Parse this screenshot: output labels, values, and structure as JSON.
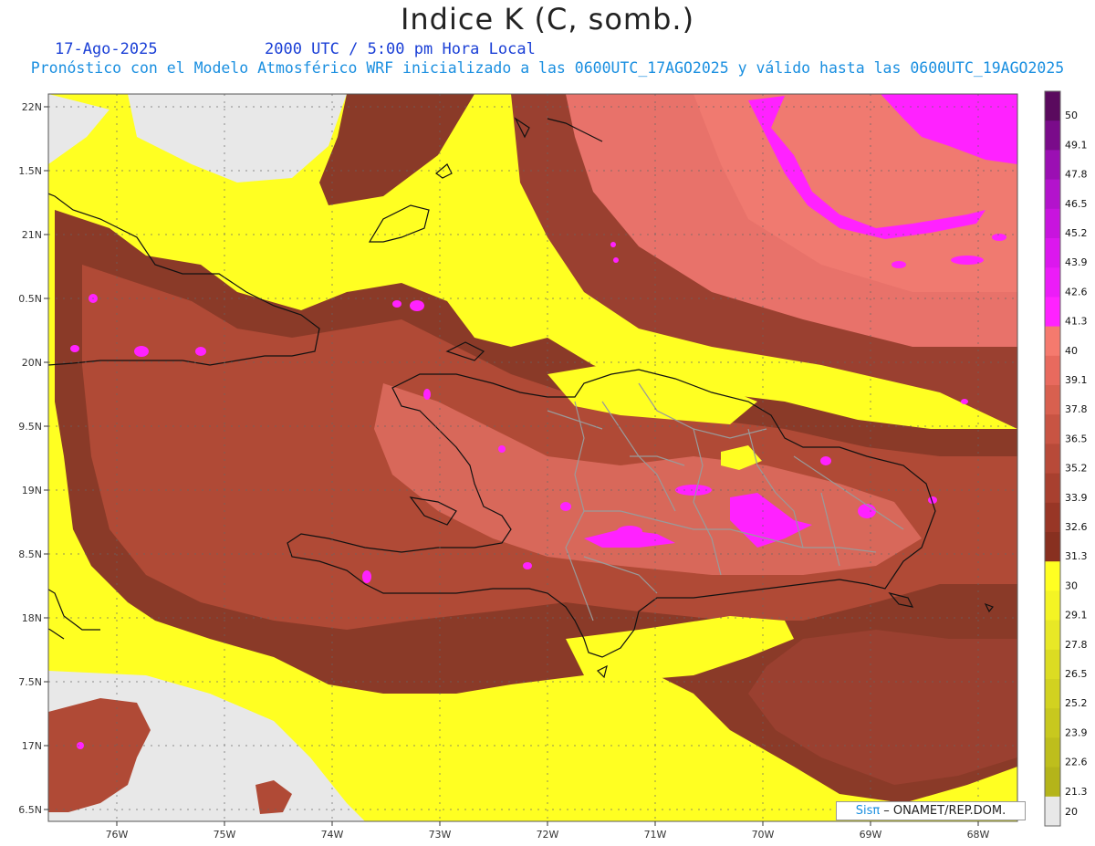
{
  "header": {
    "title": "Indice K (C, somb.)",
    "date": "17-Ago-2025",
    "time": "2000 UTC / 5:00 pm Hora Local",
    "subtitle": "Pronóstico con el Modelo Atmosférico WRF inicializado a las 0600UTC_17AGO2025 y válido hasta las  0600UTC_19AGO2025"
  },
  "axes": {
    "lon_labels": [
      "76W",
      "75W",
      "74W",
      "73W",
      "72W",
      "71W",
      "70W",
      "69W",
      "68W"
    ],
    "lat_labels": [
      "22N",
      "1.5N",
      "21N",
      "0.5N",
      "20N",
      "9.5N",
      "19N",
      "8.5N",
      "18N",
      "7.5N",
      "17N",
      "6.5N"
    ]
  },
  "colorbar": {
    "labels": [
      "50",
      "49.1",
      "47.8",
      "46.5",
      "45.2",
      "43.9",
      "42.6",
      "41.3",
      "40",
      "39.1",
      "37.8",
      "36.5",
      "35.2",
      "33.9",
      "32.6",
      "31.3",
      "30",
      "29.1",
      "27.8",
      "26.5",
      "25.2",
      "23.9",
      "22.6",
      "21.3",
      "20"
    ],
    "colors": [
      "#5a0a5e",
      "#7a0b8a",
      "#9b0fb3",
      "#b313cc",
      "#c814de",
      "#dc17ee",
      "#ec1cf8",
      "#ff22ff",
      "#f57a6e",
      "#e86a5e",
      "#d8604f",
      "#c85443",
      "#b84a39",
      "#a8402f",
      "#983626",
      "#883020",
      "#ffff22",
      "#f4f424",
      "#e8e826",
      "#dcdc22",
      "#d2d220",
      "#c8c81e",
      "#bebe1c",
      "#b4b41a",
      "#e8e8e8"
    ]
  },
  "credit": {
    "sis": "Sisπ",
    "text": "– ONAMET/REP.DOM."
  },
  "colors": {
    "land_bg": "#e8e8e8",
    "yellow": "#ffff22",
    "brown_dark": "#8a3a28",
    "brown": "#b04a36",
    "salmon": "#d8685a",
    "pink": "#f07870",
    "magenta": "#ff22ff"
  }
}
